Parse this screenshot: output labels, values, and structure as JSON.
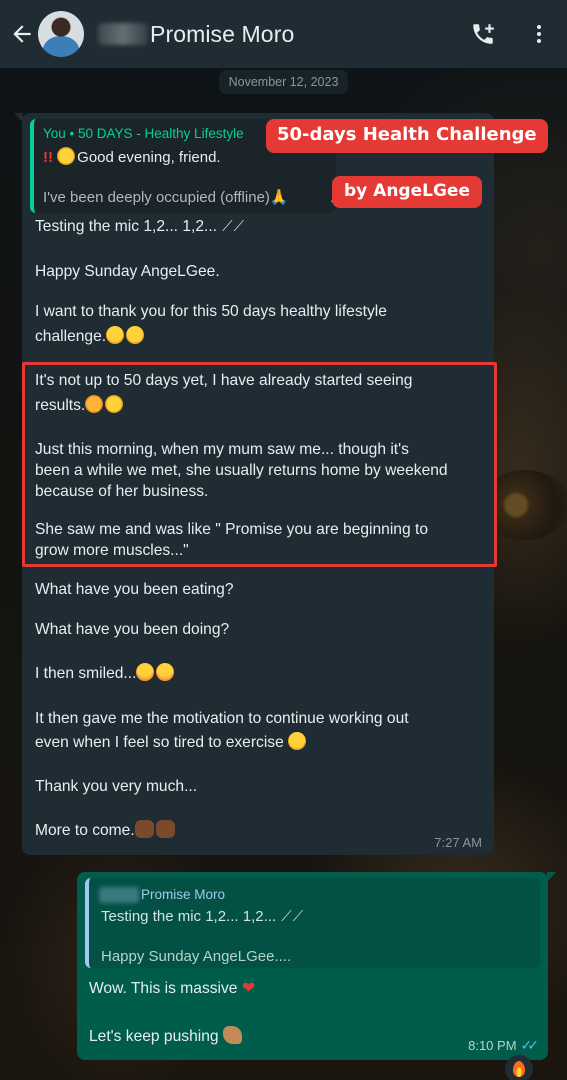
{
  "header": {
    "contact_name": "Promise Moro",
    "back_icon": "arrow-left-icon",
    "call_icon": "add-call-icon",
    "menu_icon": "more-vert-icon"
  },
  "date_chip": "November 12, 2023",
  "incoming": {
    "quote": {
      "author": "You • 50 DAYS - Healthy Lifestyle",
      "line1_prefix": "!!",
      "line1_text": "Good evening, friend.",
      "line2": "I've been deeply occupied (offline)🙏",
      "more": "..."
    },
    "messages": [
      "Testing the mic 1,2... 1,2...",
      "Happy Sunday AngeLGee.",
      "I want to thank you for this 50 days healthy lifestyle",
      "challenge.",
      "It's not up to 50 days yet, I have already started seeing",
      "results.",
      "Just this morning, when my mum saw me... though it's",
      "been a while we met, she usually returns home by weekend",
      "because of her business.",
      "She saw me and was like \" Promise you are beginning to",
      "grow more muscles...\"",
      "What have you been eating?",
      "What have you been doing?",
      "I then smiled...",
      "It then gave me the motivation to continue working out",
      "even when I feel so tired to exercise",
      "Thank you very much...",
      "More to come."
    ],
    "time": "7:27 AM"
  },
  "overlay_tags": {
    "title": "50-days Health Challenge",
    "by": "by AngeLGee"
  },
  "outgoing": {
    "quote": {
      "author": "Promise Moro",
      "line1": "Testing the mic 1,2... 1,2...",
      "line2": "Happy Sunday AngeLGee...."
    },
    "messages": [
      "Wow. This is massive",
      "Let's keep pushing"
    ],
    "time": "8:10 PM"
  },
  "colors": {
    "header_bg": "#1f2c33",
    "incoming_bg": "#202c33",
    "outgoing_bg": "#005c4b",
    "accent_green": "#06cf9c",
    "highlight_red": "#e53935",
    "read_ticks": "#53bdeb"
  }
}
